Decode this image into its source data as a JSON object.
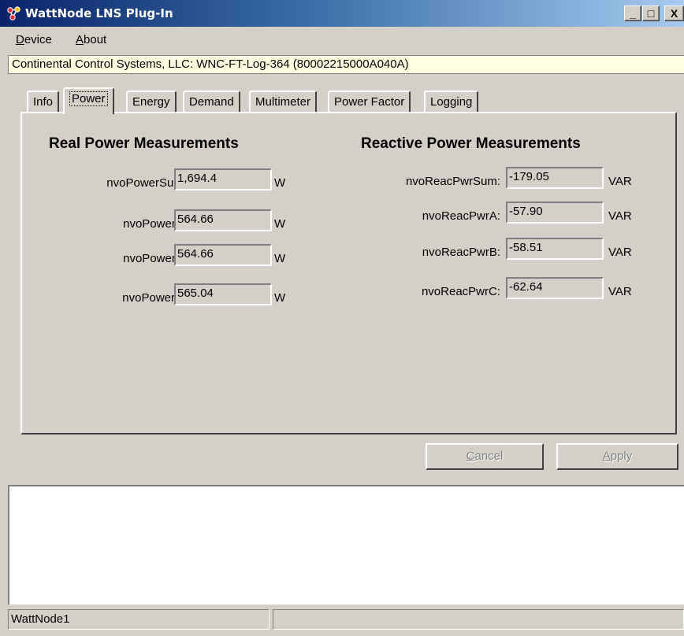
{
  "window": {
    "title": "WattNode LNS Plug-In",
    "icon": "network-nodes-icon",
    "minimize_glyph": "_",
    "maximize_glyph": "□",
    "close_glyph": "X"
  },
  "menu": {
    "device": {
      "accel": "D",
      "rest": "evice"
    },
    "about": {
      "accel": "A",
      "rest": "bout"
    }
  },
  "device_bar": "Continental Control Systems, LLC: WNC-FT-Log-364 (80002215000A040A)",
  "tabs": [
    {
      "label": "Info"
    },
    {
      "label": "Power",
      "active": true
    },
    {
      "label": "Energy"
    },
    {
      "label": "Demand"
    },
    {
      "label": "Multimeter"
    },
    {
      "label": "Power Factor"
    },
    {
      "label": "Logging"
    }
  ],
  "real": {
    "title": "Real Power Measurements",
    "rows": [
      {
        "label": "nvoPowerSum:",
        "value": "1,694.4",
        "unit": "W"
      },
      {
        "label": "nvoPowerA:",
        "value": "564.66",
        "unit": "W"
      },
      {
        "label": "nvoPowerB:",
        "value": "564.66",
        "unit": "W"
      },
      {
        "label": "nvoPowerC:",
        "value": "565.04",
        "unit": "W"
      }
    ]
  },
  "reactive": {
    "title": "Reactive Power Measurements",
    "rows": [
      {
        "label": "nvoReacPwrSum:",
        "value": "-179.05",
        "unit": "VAR"
      },
      {
        "label": "nvoReacPwrA:",
        "value": "-57.90",
        "unit": "VAR"
      },
      {
        "label": "nvoReacPwrB:",
        "value": "-58.51",
        "unit": "VAR"
      },
      {
        "label": "nvoReacPwrC:",
        "value": "-62.64",
        "unit": "VAR"
      }
    ]
  },
  "buttons": {
    "cancel": {
      "accel": "C",
      "rest": "ancel"
    },
    "apply": {
      "accel": "A",
      "rest": "pply"
    }
  },
  "status": {
    "node": "WattNode1",
    "message": ""
  },
  "colors": {
    "titlebar_start": "#0a246a",
    "titlebar_end": "#a6caf0",
    "face": "#d4d0c8",
    "device_bar_bg": "#ffffe1"
  }
}
